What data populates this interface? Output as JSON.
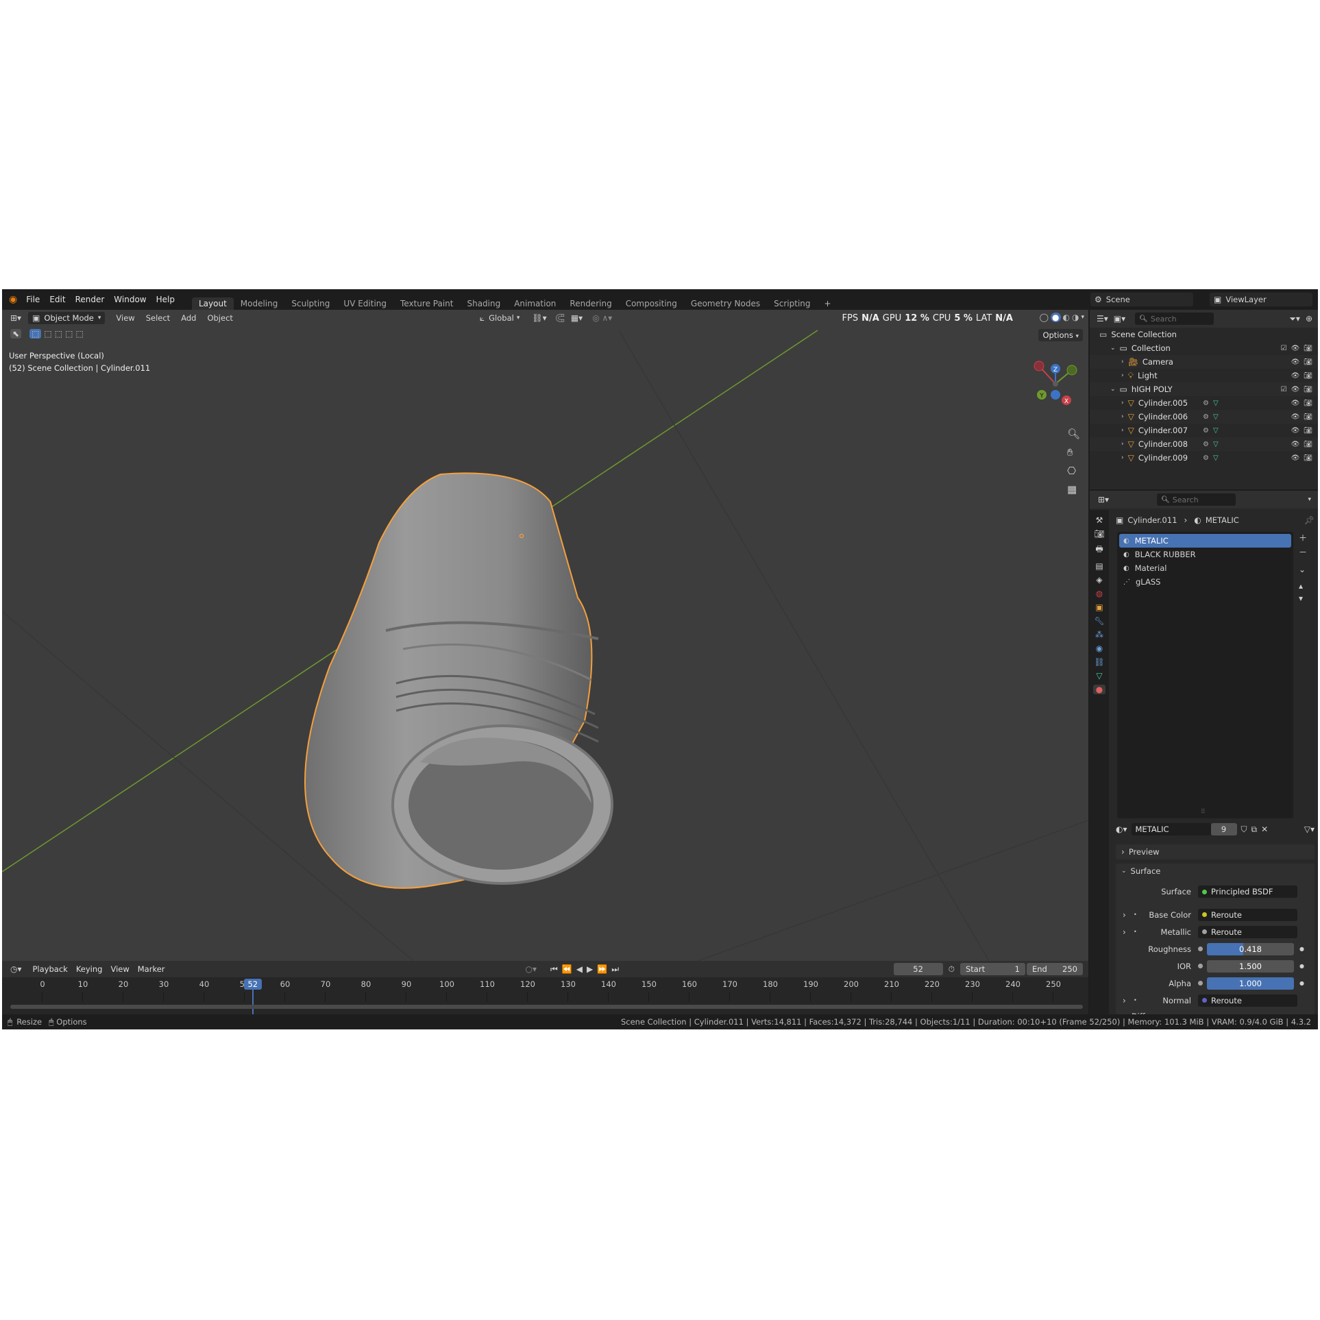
{
  "menu": {
    "file": "File",
    "edit": "Edit",
    "render": "Render",
    "window": "Window",
    "help": "Help"
  },
  "workspaces": [
    "Layout",
    "Modeling",
    "Sculpting",
    "UV Editing",
    "Texture Paint",
    "Shading",
    "Animation",
    "Rendering",
    "Compositing",
    "Geometry Nodes",
    "Scripting"
  ],
  "scene": {
    "name": "Scene",
    "view_layer": "ViewLayer"
  },
  "viewport": {
    "mode": "Object Mode",
    "view": "View",
    "select": "Select",
    "add": "Add",
    "object": "Object",
    "orientation": "Global",
    "options": "Options",
    "info_line1": "User Perspective (Local)",
    "info_line2": "(52) Scene Collection | Cylinder.011",
    "hud": {
      "fps_label": "FPS",
      "fps": "N/A",
      "gpu_label": "GPU",
      "gpu": "12 %",
      "cpu_label": "CPU",
      "cpu": "5 %",
      "lat_label": "LAT",
      "lat": "N/A"
    },
    "gizmo": {
      "x": "X",
      "y": "Y",
      "z": "Z"
    }
  },
  "outliner": {
    "search_placeholder": "Search",
    "root": "Scene Collection",
    "items": [
      {
        "name": "Collection",
        "depth": 1,
        "type": "collection"
      },
      {
        "name": "Camera",
        "depth": 2,
        "type": "camera"
      },
      {
        "name": "Light",
        "depth": 2,
        "type": "light"
      },
      {
        "name": "hIGH POLY",
        "depth": 1,
        "type": "collection"
      },
      {
        "name": "Cylinder.005",
        "depth": 2,
        "type": "mesh"
      },
      {
        "name": "Cylinder.006",
        "depth": 2,
        "type": "mesh"
      },
      {
        "name": "Cylinder.007",
        "depth": 2,
        "type": "mesh"
      },
      {
        "name": "Cylinder.008",
        "depth": 2,
        "type": "mesh"
      },
      {
        "name": "Cylinder.009",
        "depth": 2,
        "type": "mesh"
      }
    ]
  },
  "properties": {
    "search_placeholder": "Search",
    "breadcrumb_object": "Cylinder.011",
    "breadcrumb_material": "METALIC",
    "slots": [
      "METALIC",
      "BLACK RUBBER",
      "Material",
      "gLASS"
    ],
    "material_name": "METALIC",
    "user_count": "9",
    "panels": {
      "preview": "Preview",
      "surface": "Surface",
      "diffuse": "Diffuse"
    },
    "surface_label": "Surface",
    "surface_value": "Principled BSDF",
    "fields": [
      {
        "label": "Base Color",
        "value": "Reroute",
        "kind": "link",
        "dot": "#c7c729"
      },
      {
        "label": "Metallic",
        "value": "Reroute",
        "kind": "link",
        "dot": "#a1a1a1"
      },
      {
        "label": "Roughness",
        "value": "0.418",
        "kind": "slider",
        "fill": 0.418,
        "dot": "#a1a1a1"
      },
      {
        "label": "IOR",
        "value": "1.500",
        "kind": "slider",
        "fill": 0,
        "dot": "#a1a1a1"
      },
      {
        "label": "Alpha",
        "value": "1.000",
        "kind": "slider",
        "fill": 1.0,
        "dot": "#a1a1a1"
      },
      {
        "label": "Normal",
        "value": "Reroute",
        "kind": "link",
        "dot": "#6363c7"
      }
    ]
  },
  "timeline": {
    "playback": "Playback",
    "keying": "Keying",
    "view": "View",
    "marker": "Marker",
    "current_frame": "52",
    "start_label": "Start",
    "start": "1",
    "end_label": "End",
    "end": "250",
    "ticks": [
      "0",
      "10",
      "20",
      "30",
      "40",
      "50",
      "60",
      "70",
      "80",
      "90",
      "100",
      "110",
      "120",
      "130",
      "140",
      "150",
      "160",
      "170",
      "180",
      "190",
      "200",
      "210",
      "220",
      "230",
      "240",
      "250"
    ]
  },
  "status": {
    "resize": "Resize",
    "options": "Options",
    "info": "Scene Collection | Cylinder.011 | Verts:14,811 | Faces:14,372 | Tris:28,744 | Objects:1/11 | Duration: 00:10+10 (Frame 52/250) | Memory: 101.3 MiB | VRAM: 0.9/4.0 GiB | 4.3.2"
  },
  "colors": {
    "accent": "#4772b3",
    "selection_outline": "#f5a03c",
    "x_axis_line": "#6e9a2e",
    "background": "#3d3d3d"
  }
}
